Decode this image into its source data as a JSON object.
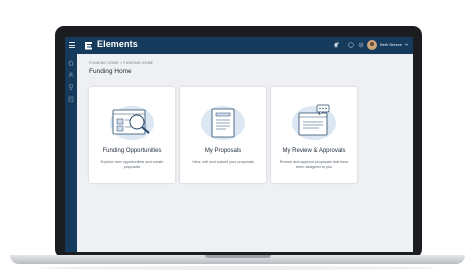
{
  "app": {
    "brand": "Elements"
  },
  "topbar": {
    "icons": [
      "menu-icon",
      "elements-logo-icon",
      "bell-icon",
      "help-icon",
      "settings-icon",
      "chevron-down-icon"
    ],
    "user_name": "Beth Breeze"
  },
  "sidenav": {
    "icons": [
      "home-icon",
      "user-icon",
      "trophy-icon",
      "building-icon"
    ]
  },
  "breadcrumb": "FUNDING HOME > FUNDING HOME",
  "page_title": "Funding Home",
  "cards": [
    {
      "title": "Funding Opportunities",
      "description": "Explore new opportunities and create proposals",
      "icon": "search-magnifier-icon"
    },
    {
      "title": "My Proposals",
      "description": "View, edit and submit your proposals",
      "icon": "document-icon"
    },
    {
      "title": "My Review & Approvals",
      "description": "Review and approve proposals that have been assigned to you",
      "icon": "review-chat-icon"
    }
  ],
  "colors": {
    "header": "#163a5c",
    "background": "#eef0f3",
    "illustration": "#dbe7f3",
    "outline": "#27486a"
  }
}
